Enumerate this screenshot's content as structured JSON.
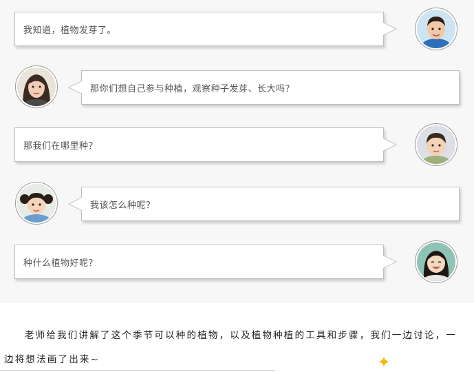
{
  "chat": {
    "messages": [
      {
        "side": "right",
        "text": "我知道，植物发芽了。",
        "avatar": "boy-avatar"
      },
      {
        "side": "left",
        "text": "那你们想自己参与种植，观察种子发芽、长大吗？",
        "avatar": "teacher-avatar"
      },
      {
        "side": "right",
        "text": "那我们在哪里种？",
        "avatar": "boy-avatar"
      },
      {
        "side": "left",
        "text": "我该怎么种呢？",
        "avatar": "girl-avatar"
      },
      {
        "side": "right",
        "text": "种什么植物好呢？",
        "avatar": "girl-avatar"
      }
    ]
  },
  "article": {
    "paragraph_line1": "老师给我们讲解了这个季节可以种的植物，以及植物种植的工具和步骤，我们一边讨论，一",
    "paragraph_line2": "边将想法画了出来~"
  },
  "colors": {
    "chat_background": "#f7f7f7",
    "bubble_border": "#bdbdbd",
    "sparkle": "#f5b800"
  },
  "icons": {
    "sparkle": "sparkle-icon"
  }
}
